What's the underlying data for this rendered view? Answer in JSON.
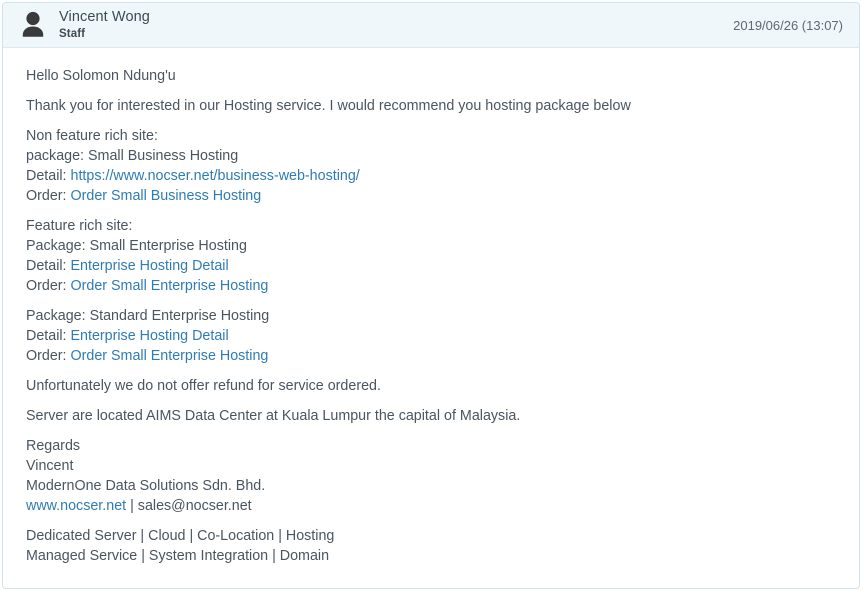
{
  "message": {
    "author": {
      "name": "Vincent Wong",
      "role": "Staff",
      "avatar_icon": "user-avatar-icon"
    },
    "timestamp": "2019/06/26 (13:07)",
    "body": {
      "greeting": "Hello Solomon Ndung'u",
      "intro": "Thank you for interested in our Hosting service. I would recommend you hosting package below",
      "block_non_feature": {
        "heading": "Non feature rich site:",
        "package_label": "package: Small Business Hosting",
        "detail_label": "Detail: ",
        "detail_link": "https://www.nocser.net/business-web-hosting/",
        "order_label": "Order: ",
        "order_link": "Order Small Business Hosting"
      },
      "block_feature": {
        "heading": "Feature rich site:",
        "package_label": "Package: Small Enterprise Hosting",
        "detail_label": "Detail: ",
        "detail_link": "Enterprise Hosting Detail",
        "order_label": "Order: ",
        "order_link": "Order Small Enterprise Hosting"
      },
      "block_standard": {
        "package_label": "Package: Standard Enterprise Hosting",
        "detail_label": "Detail: ",
        "detail_link": "Enterprise Hosting Detail",
        "order_label": "Order: ",
        "order_link": "Order Small Enterprise Hosting"
      },
      "refund_notice": "Unfortunately we do not offer refund for service ordered.",
      "server_location": "Server are located AIMS Data Center at Kuala Lumpur the capital of Malaysia.",
      "signature": {
        "regards": "Regards",
        "name": "Vincent",
        "company": "ModernOne Data Solutions Sdn. Bhd.",
        "website_link": "www.nocser.net",
        "contact_rest": " | sales@nocser.net"
      },
      "services_line_1": "Dedicated Server | Cloud | Co-Location | Hosting",
      "services_line_2": "Managed Service | System Integration | Domain"
    }
  },
  "colors": {
    "header_background": "#eff7fb",
    "panel_border": "#cfe2f1",
    "link": "#2f7cb5",
    "text": "#4a5560",
    "avatar": "#3a3a3a"
  }
}
